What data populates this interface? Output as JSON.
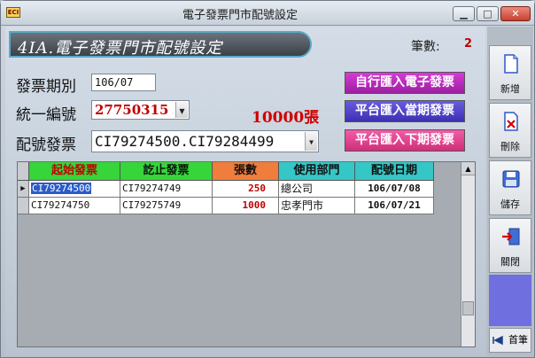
{
  "window": {
    "title": "電子發票門市配號設定",
    "app_icon": "ECI"
  },
  "banner": {
    "title": "4IA.電子發票門市配號設定"
  },
  "count": {
    "label": "筆數:",
    "value": "2"
  },
  "form": {
    "period_label": "發票期別",
    "period_value": "106/07",
    "taxid_label": "統一編號",
    "taxid_value": "27750315",
    "assign_label": "配號發票",
    "assign_value": "CI79274500.CI79284499",
    "sheets": "10000張"
  },
  "buttons": {
    "self_import": "自行匯入電子發票",
    "platform_current": "平台匯入當期發票",
    "platform_next": "平台匯入下期發票"
  },
  "grid": {
    "headers": [
      "起始發票",
      "訖止發票",
      "張數",
      "使用部門",
      "配號日期"
    ],
    "rows": [
      {
        "start": "CI79274500",
        "end": "CI79274749",
        "count": "250",
        "dept": "總公司",
        "date": "106/07/08"
      },
      {
        "start": "CI79274750",
        "end": "CI79275749",
        "count": "1000",
        "dept": "忠孝門市",
        "date": "106/07/21"
      }
    ]
  },
  "sidebar": {
    "add": "新增",
    "delete": "刪除",
    "save": "儲存",
    "close": "關閉",
    "first": "首筆"
  },
  "colors": {
    "header_green": "#37d43a",
    "header_orange": "#ef7d3b",
    "header_cyan": "#35c7c6",
    "accent_red": "#c00000"
  }
}
